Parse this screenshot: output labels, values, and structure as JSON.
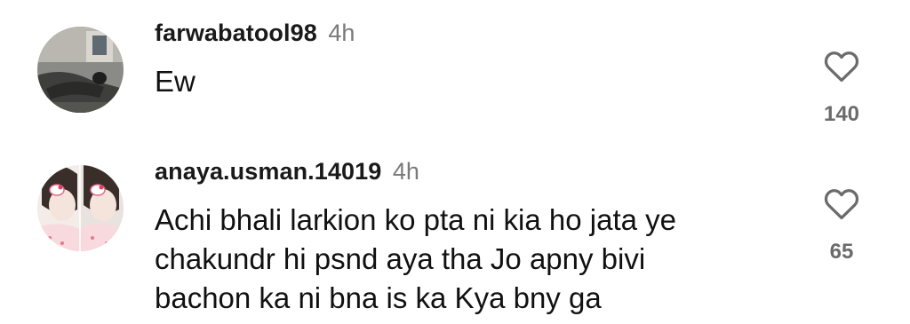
{
  "comments": [
    {
      "username": "farwabatool98",
      "time": "4h",
      "text_lines": [
        "Ew"
      ],
      "likes": "140",
      "avatar_icon": "profile-photo-person-reclining",
      "like_icon": "heart-outline-icon"
    },
    {
      "username": "anaya.usman.14019",
      "time": "4h",
      "text_lines": [
        "Achi bhali larkion ko pta ni kia ho jata ye",
        "chakundr hi psnd aya tha Jo apny bivi",
        "bachon ka ni bna is ka Kya bny ga"
      ],
      "likes": "65",
      "avatar_icon": "profile-photo-girl-with-hello-kitty-clip",
      "like_icon": "heart-outline-icon"
    }
  ],
  "colors": {
    "background": "#ffffff",
    "username": "#1a1a1a",
    "timestamp": "#7a7a7a",
    "text": "#111111",
    "like_count": "#6b6b6b"
  }
}
